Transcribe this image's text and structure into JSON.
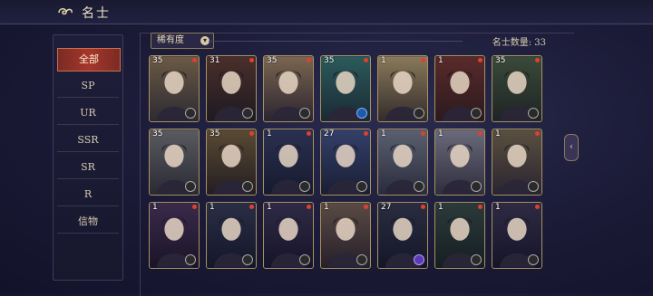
{
  "header": {
    "title": "名士"
  },
  "sidebar": {
    "items": [
      {
        "label": "全部",
        "active": true
      },
      {
        "label": "SP"
      },
      {
        "label": "UR"
      },
      {
        "label": "SSR"
      },
      {
        "label": "SR"
      },
      {
        "label": "R"
      },
      {
        "label": "信物"
      }
    ]
  },
  "toolbar": {
    "filter_label": "稀有度",
    "count_text": "名士数量: 33"
  },
  "cards": [
    {
      "level": "35",
      "reddot": true,
      "badge": "gray"
    },
    {
      "level": "31",
      "reddot": true,
      "badge": "gray"
    },
    {
      "level": "35",
      "reddot": true,
      "badge": "gray"
    },
    {
      "level": "35",
      "reddot": true,
      "badge": "blue"
    },
    {
      "level": "1",
      "reddot": true,
      "badge": "gray"
    },
    {
      "level": "1",
      "reddot": true,
      "badge": "gray"
    },
    {
      "level": "35",
      "reddot": true,
      "badge": "gray"
    },
    {
      "level": "35",
      "reddot": false,
      "badge": "gray"
    },
    {
      "level": "35",
      "reddot": true,
      "badge": "gray"
    },
    {
      "level": "1",
      "reddot": true,
      "badge": "gray"
    },
    {
      "level": "27",
      "reddot": true,
      "badge": "gray"
    },
    {
      "level": "1",
      "reddot": true,
      "badge": "gray"
    },
    {
      "level": "1",
      "reddot": true,
      "badge": "gray"
    },
    {
      "level": "1",
      "reddot": true,
      "badge": "gray"
    },
    {
      "level": "1",
      "reddot": true,
      "badge": "gray"
    },
    {
      "level": "1",
      "reddot": true,
      "badge": "gray"
    },
    {
      "level": "1",
      "reddot": true,
      "badge": "gray"
    },
    {
      "level": "1",
      "reddot": true,
      "badge": "gray"
    },
    {
      "level": "27",
      "reddot": true,
      "badge": "purple"
    },
    {
      "level": "1",
      "reddot": true,
      "badge": "gray"
    },
    {
      "level": "1",
      "reddot": true,
      "badge": "gray"
    }
  ],
  "colors": {
    "accent_red": "#a6362c",
    "gold_border": "#a8915e",
    "background": "#1a1a36"
  },
  "icons": {
    "back": "cloud-scroll-icon",
    "filter": "chevron-down-icon",
    "side": "chevron-left-icon"
  }
}
